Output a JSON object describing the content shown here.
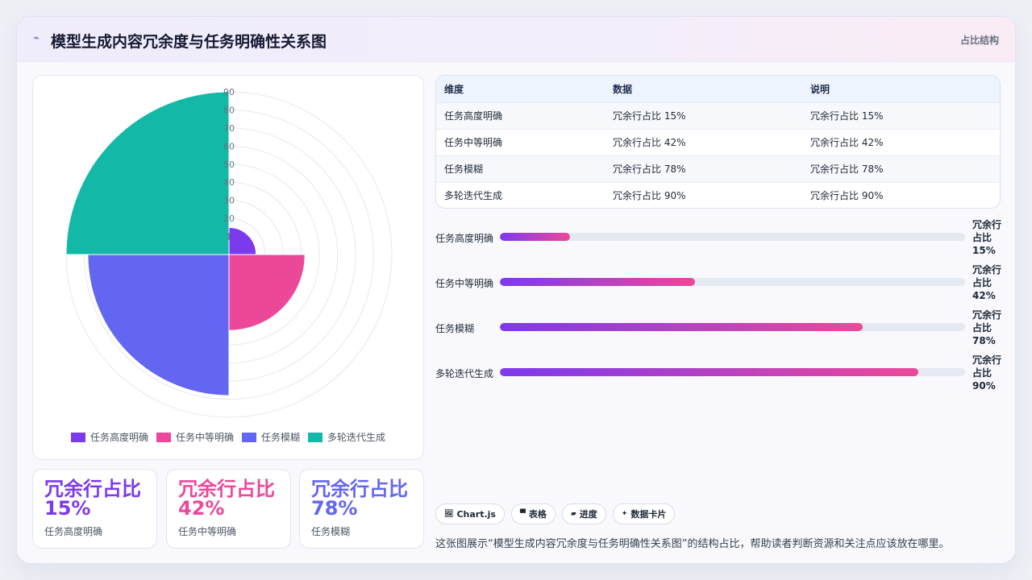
{
  "header": {
    "icon": "trend-icon",
    "title": "模型生成内容冗余度与任务明确性关系图",
    "tag": "占比结构"
  },
  "chart_data": {
    "type": "polarArea",
    "categories": [
      "任务高度明确",
      "任务中等明确",
      "任务模糊",
      "多轮迭代生成"
    ],
    "values": [
      15,
      42,
      78,
      90
    ],
    "colors": [
      "#7c3aed",
      "#ec4899",
      "#6366f1",
      "#14b8a6"
    ],
    "r_ticks": [
      "1",
      "20",
      "30",
      "40",
      "50",
      "60",
      "70",
      "80",
      "90"
    ],
    "rlim": [
      0,
      90
    ],
    "grid": true,
    "legend_position": "bottom"
  },
  "kpis": [
    {
      "value": "冗余行占比 15%",
      "label": "任务高度明确",
      "color": "#7c3aed"
    },
    {
      "value": "冗余行占比 42%",
      "label": "任务中等明确",
      "color": "#ec4899"
    },
    {
      "value": "冗余行占比 78%",
      "label": "任务模糊",
      "color": "#6366f1"
    }
  ],
  "table": {
    "headers": [
      "维度",
      "数据",
      "说明"
    ],
    "rows": [
      [
        "任务高度明确",
        "冗余行占比 15%",
        "冗余行占比 15%"
      ],
      [
        "任务中等明确",
        "冗余行占比 42%",
        "冗余行占比 42%"
      ],
      [
        "任务模糊",
        "冗余行占比 78%",
        "冗余行占比 78%"
      ],
      [
        "多轮迭代生成",
        "冗余行占比 90%",
        "冗余行占比 90%"
      ]
    ]
  },
  "progress": [
    {
      "label": "任务高度明确",
      "value": 15,
      "value_text": "冗余行占比15%"
    },
    {
      "label": "任务中等明确",
      "value": 42,
      "value_text": "冗余行占比42%"
    },
    {
      "label": "任务模糊",
      "value": 78,
      "value_text": "冗余行占比78%"
    },
    {
      "label": "多轮迭代生成",
      "value": 90,
      "value_text": "冗余行占比90%"
    }
  ],
  "chips": [
    {
      "icon": "chart-js-icon",
      "glyph": "🖼",
      "label": "Chart.js"
    },
    {
      "icon": "table-icon",
      "glyph": "▀",
      "label": "表格"
    },
    {
      "icon": "progress-icon",
      "glyph": "▰",
      "label": "进度"
    },
    {
      "icon": "sparkle-icon",
      "glyph": "✦",
      "label": "数据卡片"
    }
  ],
  "note": "这张图展示“模型生成内容冗余度与任务明确性关系图”的结构占比，帮助读者判断资源和关注点应该放在哪里。"
}
